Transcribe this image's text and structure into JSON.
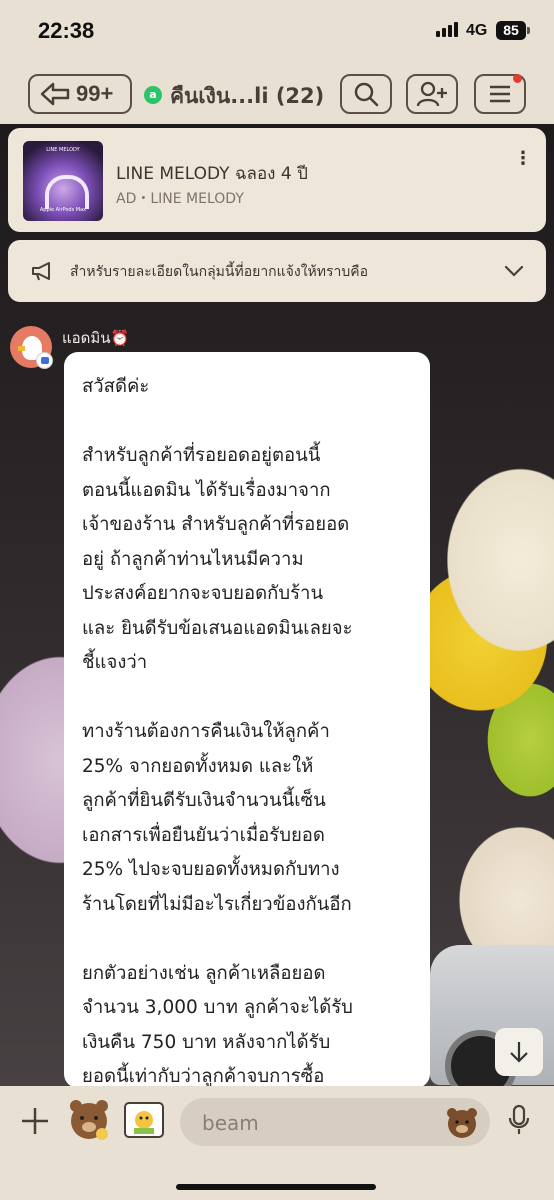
{
  "status_bar": {
    "time": "22:38",
    "network": "4G",
    "battery": "85"
  },
  "header": {
    "back_count": "99+",
    "group_icon": "group-dot-icon",
    "title": "คืนเงิน...li (22)"
  },
  "ad": {
    "title": "LINE MELODY ฉลอง 4 ปี",
    "subtitle": "AD・LINE MELODY",
    "thumb_top": "LINE MELODY",
    "thumb_bottom": "Apple AirPods Max"
  },
  "announcement": {
    "text": "สำหรับรายละเอียดในกลุ่มนี้ที่อยากแจ้งให้ทราบคือ"
  },
  "message": {
    "sender": "แอดมิน⏰",
    "text": "สวัสดีค่ะ\n\nสำหรับลูกค้าที่รอยอดอยู่ตอนนี้\nตอนนี้แอดมิน ได้รับเรื่องมาจาก\nเจ้าของร้าน สำหรับลูกค้าที่รอยอด\nอยู่ ถ้าลูกค้าท่านไหนมีความ\nประสงค์อยากจะจบยอดกับร้าน\nและ ยินดีรับข้อเสนอแอดมินเลยจะ\nชี้แจงว่า\n\nทางร้านต้องการคืนเงินให้ลูกค้า\n25% จากยอดทั้งหมด และให้\nลูกค้าที่ยินดีรับเงินจำนวนนี้เซ็น\nเอกสารเพื่อยืนยันว่าเมื่อรับยอด\n25% ไปจะจบยอดทั้งหมดกับทาง\nร้านโดยที่ไม่มีอะไรเกี่ยวข้องกันอีก\n\nยกตัวอย่างเช่น ลูกค้าเหลือยอด\nจำนวน 3,000 บาท ลูกค้าจะได้รับ\nเงินคืน 750 บาท หลังจากได้รับ\nยอดนี้เท่ากับว่าลูกค้าจบการซื้อ"
  },
  "input": {
    "placeholder": "beam"
  },
  "icons": {
    "back": "back-arrow-icon",
    "search": "search-icon",
    "add_friend": "add-friend-icon",
    "menu": "menu-icon",
    "megaphone": "megaphone-icon",
    "chevron": "chevron-down-icon",
    "plus": "plus-icon",
    "sticker": "brown-sticker-icon",
    "photo": "photo-icon",
    "emoji": "emoji-icon",
    "mic": "mic-icon",
    "scroll_down": "arrow-down-icon"
  },
  "colors": {
    "header_bg": "#e9e0d4",
    "accent_dark": "#4a3e38",
    "notification": "#e23b2f",
    "group_green": "#2cc46b"
  }
}
